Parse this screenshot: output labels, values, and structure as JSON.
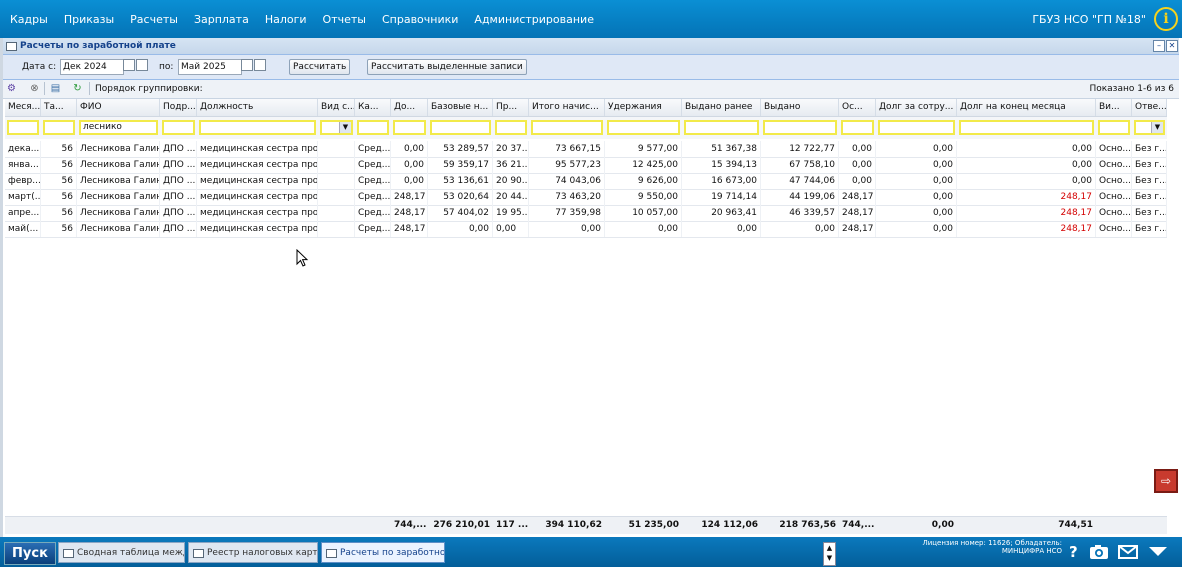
{
  "topbar": {
    "menu": [
      "Кадры",
      "Приказы",
      "Расчеты",
      "Зарплата",
      "Налоги",
      "Отчеты",
      "Справочники",
      "Администрирование"
    ],
    "org": "ГБУЗ НСО \"ГП №18\"",
    "info_icon": "i"
  },
  "window": {
    "title": "Расчеты по заработной плате",
    "minimize": "–",
    "close": "✕"
  },
  "params": {
    "date_from_label": "Дата с:",
    "date_from": "Дек 2024",
    "date_to_label": "по:",
    "date_to": "Май 2025",
    "calc_button": "Рассчитать",
    "calc_selected_button": "Рассчитать выделенные записи"
  },
  "toolbar": {
    "grouping_label": "Порядок группировки:",
    "shown": "Показано 1-6 из 6"
  },
  "grid": {
    "headers": [
      "Меся...",
      "Та...",
      "ФИО",
      "Подр...",
      "Должность",
      "Вид с...",
      "Ка...",
      "До...",
      "Базовые н...",
      "Пр...",
      "Итого начис...",
      "Удержания",
      "Выдано ранее",
      "Выдано",
      "Ос...",
      "Долг за сотру...",
      "Долг на конец месяца",
      "Ви...",
      "Отве..."
    ],
    "filter_fio": "леснико",
    "rows": [
      [
        "дека...",
        "56",
        "Лесникова Галин...",
        "ДПО ...",
        "медицинская сестра проце...",
        "",
        "Сред...",
        "0,00",
        "53 289,57",
        "20 37...",
        "73 667,15",
        "9 577,00",
        "51 367,38",
        "12 722,77",
        "0,00",
        "0,00",
        "0,00",
        "Осно...",
        "Без г..."
      ],
      [
        "янва...",
        "56",
        "Лесникова Галин...",
        "ДПО ...",
        "медицинская сестра проце...",
        "",
        "Сред...",
        "0,00",
        "59 359,17",
        "36 21...",
        "95 577,23",
        "12 425,00",
        "15 394,13",
        "67 758,10",
        "0,00",
        "0,00",
        "0,00",
        "Осно...",
        "Без г..."
      ],
      [
        "февр...",
        "56",
        "Лесникова Галин...",
        "ДПО ...",
        "медицинская сестра проце...",
        "",
        "Сред...",
        "0,00",
        "53 136,61",
        "20 90...",
        "74 043,06",
        "9 626,00",
        "16 673,00",
        "47 744,06",
        "0,00",
        "0,00",
        "0,00",
        "Осно...",
        "Без г..."
      ],
      [
        "март(...",
        "56",
        "Лесникова Галин...",
        "ДПО ...",
        "медицинская сестра проце...",
        "",
        "Сред...",
        "248,17",
        "53 020,64",
        "20 44...",
        "73 463,20",
        "9 550,00",
        "19 714,14",
        "44 199,06",
        "248,17",
        "0,00",
        "248,17",
        "Осно...",
        "Без г..."
      ],
      [
        "апре...",
        "56",
        "Лесникова Галин...",
        "ДПО ...",
        "медицинская сестра проце...",
        "",
        "Сред...",
        "248,17",
        "57 404,02",
        "19 95...",
        "77 359,98",
        "10 057,00",
        "20 963,41",
        "46 339,57",
        "248,17",
        "0,00",
        "248,17",
        "Осно...",
        "Без г..."
      ],
      [
        "май(...",
        "56",
        "Лесникова Галин...",
        "ДПО ...",
        "медицинская сестра проце...",
        "",
        "Сред...",
        "248,17",
        "0,00",
        "0,00",
        "0,00",
        "0,00",
        "0,00",
        "0,00",
        "248,17",
        "0,00",
        "248,17",
        "Осно...",
        "Без г..."
      ]
    ],
    "totals": [
      "",
      "",
      "",
      "",
      "",
      "",
      "",
      "744,...",
      "276 210,01",
      "117 ...",
      "394 110,62",
      "51 235,00",
      "124 112,06",
      "218 763,56",
      "744,...",
      "0,00",
      "744,51",
      "",
      ""
    ]
  },
  "taskbar": {
    "start": "Пуск",
    "tasks": [
      "Сводная таблица между ...",
      "Реестр налоговых карточек",
      "Расчеты по заработной ..."
    ],
    "license_line1": "Лицензия номер: 11626; Обладатель:",
    "license_line2": "МИНЦИФРА НСО",
    "help_icon": "?"
  }
}
